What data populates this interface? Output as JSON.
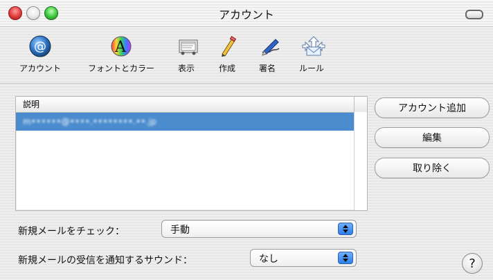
{
  "window": {
    "title": "アカウント"
  },
  "toolbar": {
    "items": [
      {
        "label": "アカウント",
        "icon": "at-sign-icon"
      },
      {
        "label": "フォントとカラー",
        "icon": "font-color-icon"
      },
      {
        "label": "表示",
        "icon": "view-icon"
      },
      {
        "label": "作成",
        "icon": "pencil-icon"
      },
      {
        "label": "署名",
        "icon": "signature-pen-icon"
      },
      {
        "label": "ルール",
        "icon": "rules-icon"
      }
    ]
  },
  "accounts_list": {
    "header": "説明",
    "rows": [
      {
        "description": "m••••••@••••.••••••••.••.jp"
      }
    ]
  },
  "buttons": {
    "add_account": "アカウント追加",
    "edit": "編集",
    "remove": "取り除く"
  },
  "settings": {
    "check_mail_label": "新規メールをチェック：",
    "check_mail_value": "手動",
    "notify_sound_label": "新規メールの受信を通知するサウンド：",
    "notify_sound_value": "なし"
  },
  "help": {
    "label": "?"
  },
  "colors": {
    "selection_blue": "#4b8ccf"
  }
}
